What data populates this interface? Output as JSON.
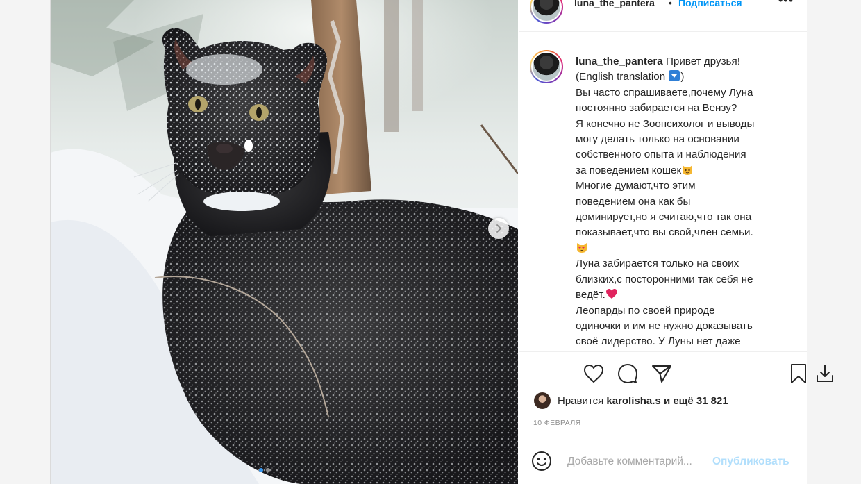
{
  "header": {
    "username": "luna_the_pantera",
    "separator": "•",
    "follow_label": "Подписаться",
    "more_label": "•••"
  },
  "caption": {
    "username": "luna_the_pantera",
    "lines": [
      "Привет друзья!",
      "(English translation",
      "Вы часто спрашиваете,почему Луна",
      "постоянно забирается на Вензу?",
      "Я конечно не Зоопсихолог и выводы",
      "могу делать только на основании",
      "собственного опыта и наблюдения",
      "за поведением кошек",
      "Многие думают,что этим",
      "поведением она как бы",
      "доминирует,но я считаю,что так она",
      "показывает,что вы свой,член семьи.",
      "",
      "Луна забирается только на своих",
      "близких,с посторонними так себя не",
      "ведёт.",
      "Леопарды по своей природе",
      "одиночки и им не нужно доказывать",
      "своё лидерство. У Луны нет даже"
    ],
    "translation_close": ")"
  },
  "likes": {
    "prefix": "Нравится",
    "user": "karolisha.s",
    "suffix": "и ещё 31 821"
  },
  "date": "10 ФЕВРАЛЯ",
  "comment": {
    "placeholder": "Добавьте комментарий...",
    "publish_label": "Опубликовать"
  },
  "icons": {
    "like": "heart-icon",
    "comment": "comment-icon",
    "share": "paper-plane-icon",
    "save": "bookmark-icon",
    "download": "download-icon",
    "emoji": "smiley-icon",
    "next": "chevron-right-icon"
  },
  "colors": {
    "accent": "#0095f6",
    "publish_disabled": "#b2dffc",
    "text": "#262626",
    "muted": "#8e8e8e"
  }
}
